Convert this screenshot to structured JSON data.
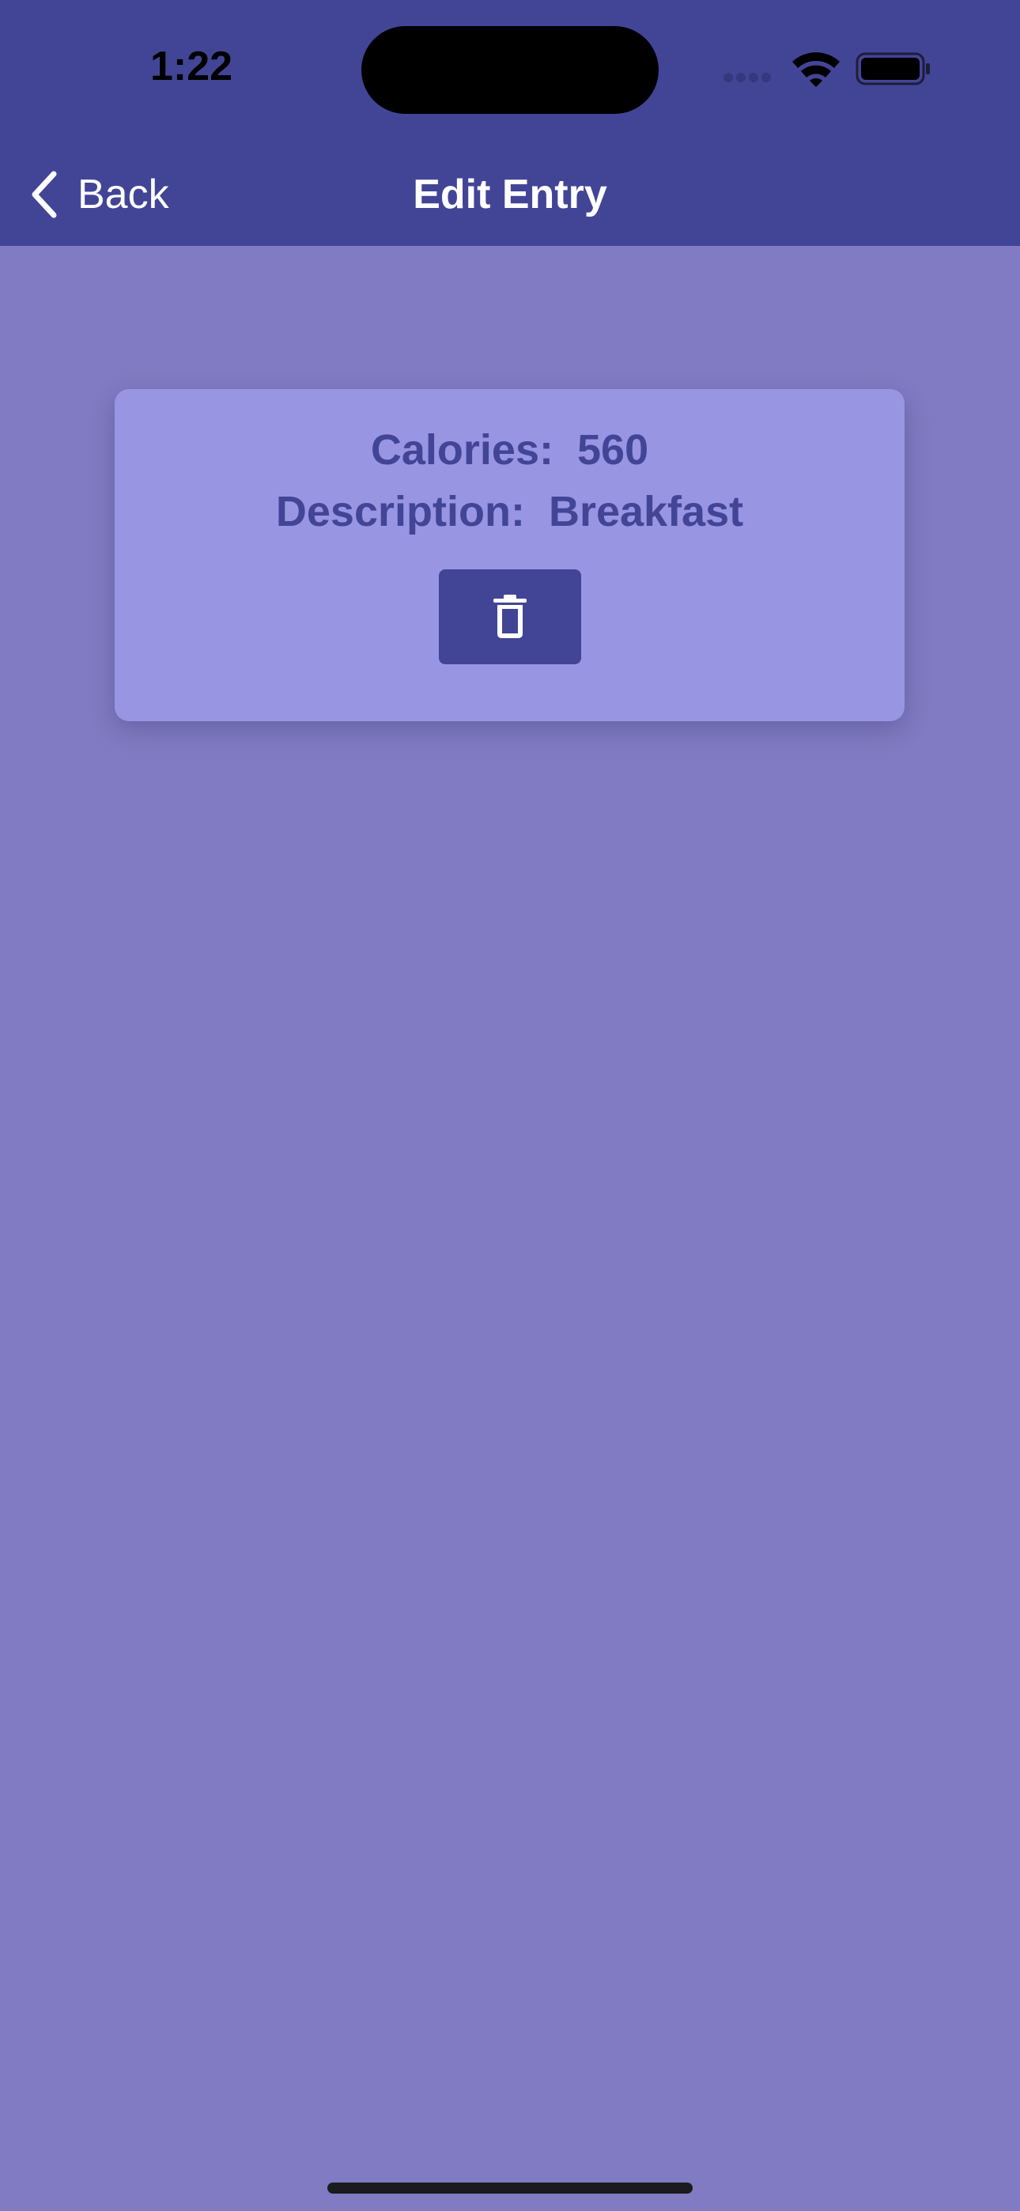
{
  "status_bar": {
    "time": "1:22",
    "icons": [
      "cellular-signal-icon",
      "wifi-icon",
      "battery-icon"
    ]
  },
  "nav": {
    "back_label": "Back",
    "back_icon": "chevron-left-icon",
    "title": "Edit Entry"
  },
  "entry": {
    "calories_label": "Calories:",
    "calories_value": "560",
    "description_label": "Description:",
    "description_value": "Breakfast",
    "delete_icon": "trash-icon"
  },
  "colors": {
    "header": "#424596",
    "background": "#807bc2",
    "card": "#9895e2",
    "accent_text": "#424596",
    "button": "#424596"
  }
}
